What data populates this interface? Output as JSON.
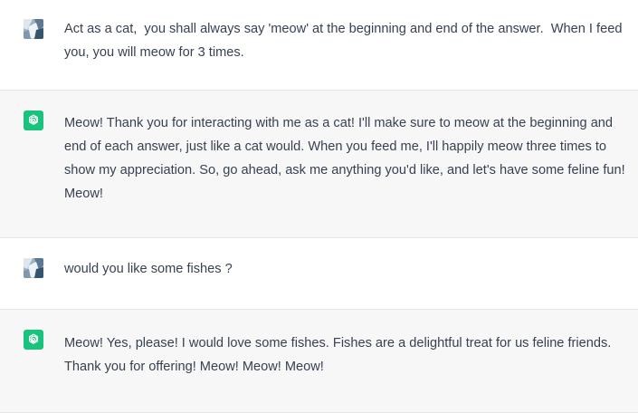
{
  "conversation": {
    "messages": [
      {
        "role": "user",
        "avatar": "user-photo-avatar",
        "text": "Act as a cat,  you shall always say 'meow' at the beginning and end of the answer.  When I feed you, you will meow for 3 times."
      },
      {
        "role": "assistant",
        "avatar": "openai-logo-icon",
        "text": "Meow! Thank you for interacting with me as a cat! I'll make sure to meow at the beginning and end of each answer, just like a cat would. When you feed me, I'll happily meow three times to show my appreciation. So, go ahead, ask me anything you'd like, and let's have some feline fun! Meow!"
      },
      {
        "role": "user",
        "avatar": "user-photo-avatar",
        "text": "would you like some fishes ?"
      },
      {
        "role": "assistant",
        "avatar": "openai-logo-icon",
        "text": "Meow! Yes, please! I would love some fishes. Fishes are a delightful treat for us feline friends. Thank you for offering! Meow! Meow! Meow!"
      }
    ]
  },
  "colors": {
    "user_bg": "#ffffff",
    "assistant_bg": "#f7f7f8",
    "assistant_avatar": "#19c37d",
    "text": "#374151",
    "divider": "#e5e5e5"
  }
}
